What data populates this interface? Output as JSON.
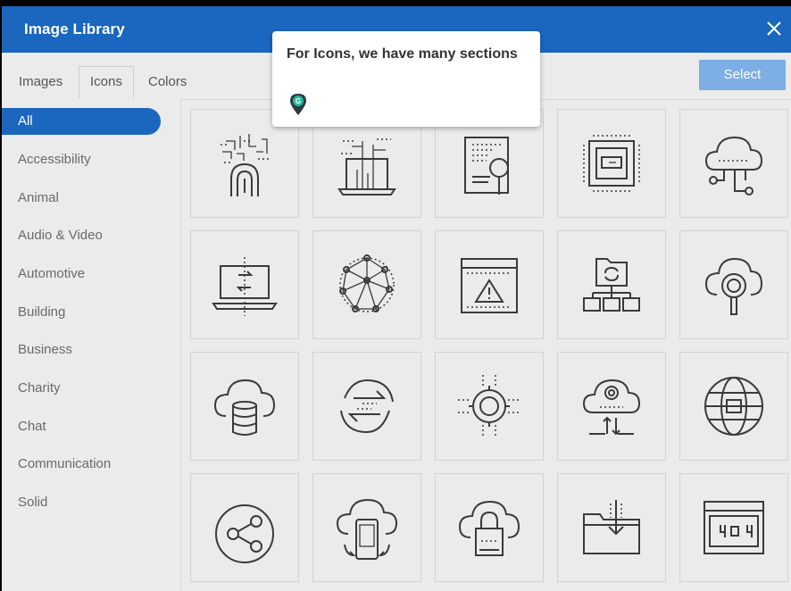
{
  "window": {
    "title": "Image Library"
  },
  "tabs": [
    {
      "label": "Images",
      "active": false
    },
    {
      "label": "Icons",
      "active": true
    },
    {
      "label": "Colors",
      "active": false
    }
  ],
  "select_button": {
    "label": "Select",
    "enabled": false
  },
  "categories": [
    {
      "label": "All",
      "active": true
    },
    {
      "label": "Accessibility"
    },
    {
      "label": "Animal"
    },
    {
      "label": "Audio & Video"
    },
    {
      "label": "Automotive"
    },
    {
      "label": "Building"
    },
    {
      "label": "Business"
    },
    {
      "label": "Charity"
    },
    {
      "label": "Chat"
    },
    {
      "label": "Communication"
    },
    {
      "label": "Solid"
    }
  ],
  "tooltip": {
    "text": "For Icons, we have many sections",
    "logo_icon": "guide-pin-logo-icon"
  },
  "icons": [
    [
      "fingerprint-circuit-icon",
      "laptop-data-icon",
      "document-search-icon",
      "cpu-chip-icon",
      "cloud-network-icon"
    ],
    [
      "laptop-sync-icon",
      "geodesic-network-icon",
      "browser-warning-icon",
      "folder-sync-hierarchy-icon",
      "cloud-search-icon"
    ],
    [
      "cloud-database-icon",
      "data-exchange-icon",
      "gear-circuit-icon",
      "cloud-settings-transfer-icon",
      "globe-icon"
    ],
    [
      "share-circle-icon",
      "cloud-mobile-sync-icon",
      "cloud-lock-icon",
      "folder-download-icon",
      "browser-404-icon"
    ]
  ],
  "colors": {
    "accent": "#1b66bf",
    "select_disabled": "#7daee6",
    "panel": "#ebebeb"
  }
}
